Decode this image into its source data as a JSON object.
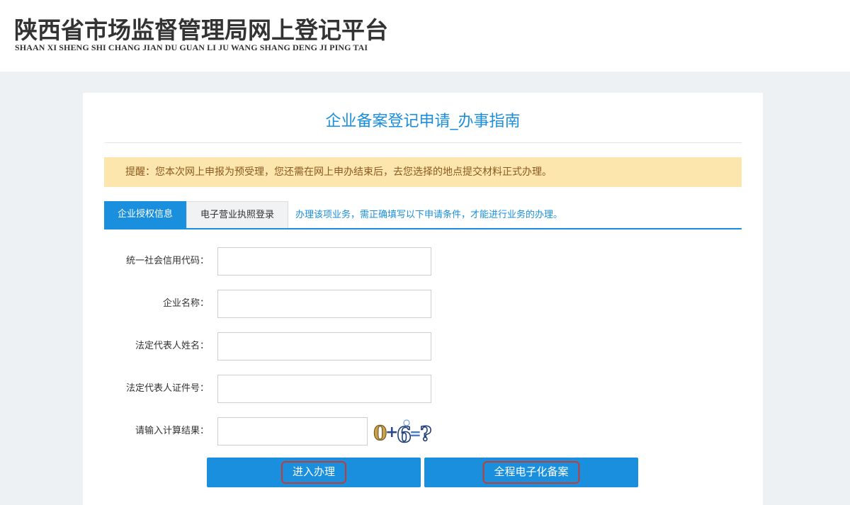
{
  "header": {
    "title": "陕西省市场监督管理局网上登记平台",
    "subtitle": "SHAAN XI SHENG SHI CHANG JIAN DU GUAN LI JU WANG SHANG DENG JI PING TAI"
  },
  "page": {
    "title": "企业备案登记申请_办事指南"
  },
  "notice": {
    "text": "提醒：您本次网上申报为预受理，您还需在网上申办结束后，去您选择的地点提交材料正式办理。"
  },
  "tabs": {
    "items": [
      {
        "label": "企业授权信息",
        "active": true
      },
      {
        "label": "电子营业执照登录",
        "active": false
      }
    ],
    "hint": "办理该项业务，需正确填写以下申请条件，才能进行业务的办理。"
  },
  "form": {
    "fields": [
      {
        "label": "统一社会信用代码：",
        "value": ""
      },
      {
        "label": "企业名称：",
        "value": ""
      },
      {
        "label": "法定代表人姓名：",
        "value": ""
      },
      {
        "label": "法定代表人证件号：",
        "value": ""
      },
      {
        "label": "请输入计算结果：",
        "value": ""
      }
    ],
    "captcha_text": "0+6=?"
  },
  "buttons": {
    "enter": "进入办理",
    "full_electronic": "全程电子化备案"
  },
  "colors": {
    "accent": "#1a8fdd",
    "notice_bg": "#fde6ad",
    "highlight_border": "#c43c30"
  }
}
